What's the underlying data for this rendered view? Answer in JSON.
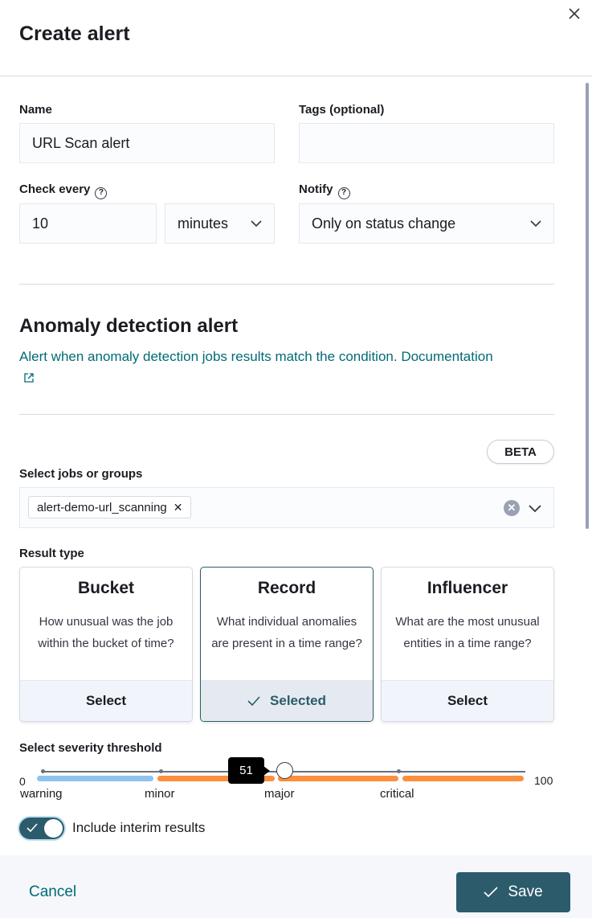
{
  "header": {
    "title": "Create alert"
  },
  "form": {
    "name_label": "Name",
    "name_value": "URL Scan alert",
    "tags_label": "Tags (optional)",
    "tags_value": "",
    "check_every_label": "Check every",
    "check_every_value": "10",
    "check_every_unit": "minutes",
    "notify_label": "Notify",
    "notify_value": "Only on status change"
  },
  "anomaly": {
    "title": "Anomaly detection alert",
    "description": "Alert when anomaly detection jobs results match the condition.",
    "doc_link": "Documentation",
    "beta_badge": "BETA",
    "jobs_label": "Select jobs or groups",
    "selected_job": "alert-demo-url_scanning"
  },
  "result_type": {
    "label": "Result type",
    "cards": [
      {
        "title": "Bucket",
        "description": "How unusual was the job within the bucket of time?",
        "action": "Select",
        "selected": false
      },
      {
        "title": "Record",
        "description": "What individual anomalies are present in a time range?",
        "action": "Selected",
        "selected": true
      },
      {
        "title": "Influencer",
        "description": "What are the most unusual entities in a time range?",
        "action": "Select",
        "selected": false
      }
    ]
  },
  "severity": {
    "label": "Select severity threshold",
    "min": "0",
    "max": "100",
    "value": "51",
    "ticks": [
      "warning",
      "minor",
      "major",
      "critical"
    ],
    "colors": {
      "warning": "#8ec3ef",
      "minor": "#fb8f3d",
      "major": "#fb8f3d",
      "critical": "#fb8f3d"
    }
  },
  "interim": {
    "label": "Include interim results",
    "checked": true
  },
  "footer": {
    "cancel_label": "Cancel",
    "save_label": "Save"
  },
  "colors": {
    "accent": "#2c5c6b",
    "link": "#006b75"
  }
}
